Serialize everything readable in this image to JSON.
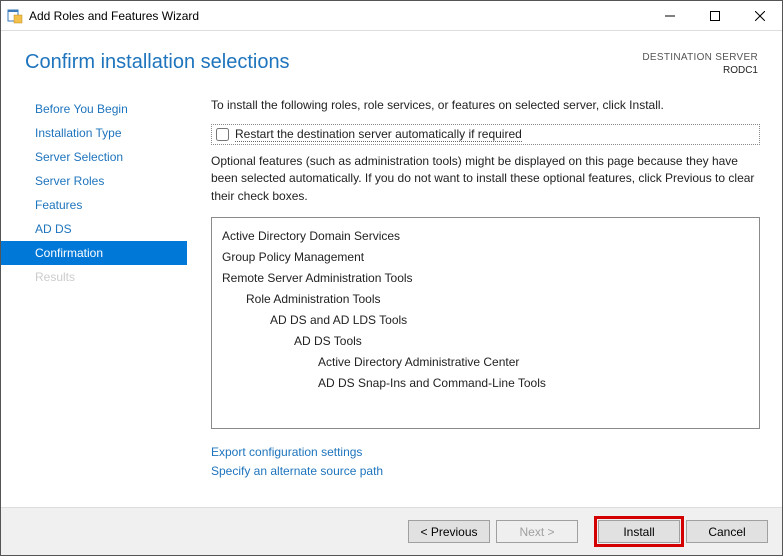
{
  "titlebar": {
    "title": "Add Roles and Features Wizard"
  },
  "header": {
    "page_title": "Confirm installation selections",
    "dest_label": "DESTINATION SERVER",
    "dest_server": "RODC1"
  },
  "sidebar": {
    "items": [
      "Before You Begin",
      "Installation Type",
      "Server Selection",
      "Server Roles",
      "Features",
      "AD DS",
      "Confirmation",
      "Results"
    ]
  },
  "content": {
    "intro": "To install the following roles, role services, or features on selected server, click Install.",
    "restart_label": "Restart the destination server automatically if required",
    "optional": "Optional features (such as administration tools) might be displayed on this page because they have been selected automatically. If you do not want to install these optional features, click Previous to clear their check boxes.",
    "features": [
      {
        "lvl": 0,
        "text": "Active Directory Domain Services"
      },
      {
        "lvl": 0,
        "text": "Group Policy Management"
      },
      {
        "lvl": 0,
        "text": "Remote Server Administration Tools"
      },
      {
        "lvl": 1,
        "text": "Role Administration Tools"
      },
      {
        "lvl": 2,
        "text": "AD DS and AD LDS Tools"
      },
      {
        "lvl": 3,
        "text": "AD DS Tools"
      },
      {
        "lvl": 4,
        "text": "Active Directory Administrative Center"
      },
      {
        "lvl": 4,
        "text": "AD DS Snap-Ins and Command-Line Tools"
      }
    ],
    "link_export": "Export configuration settings",
    "link_source": "Specify an alternate source path"
  },
  "footer": {
    "previous": "< Previous",
    "next": "Next >",
    "install": "Install",
    "cancel": "Cancel"
  }
}
